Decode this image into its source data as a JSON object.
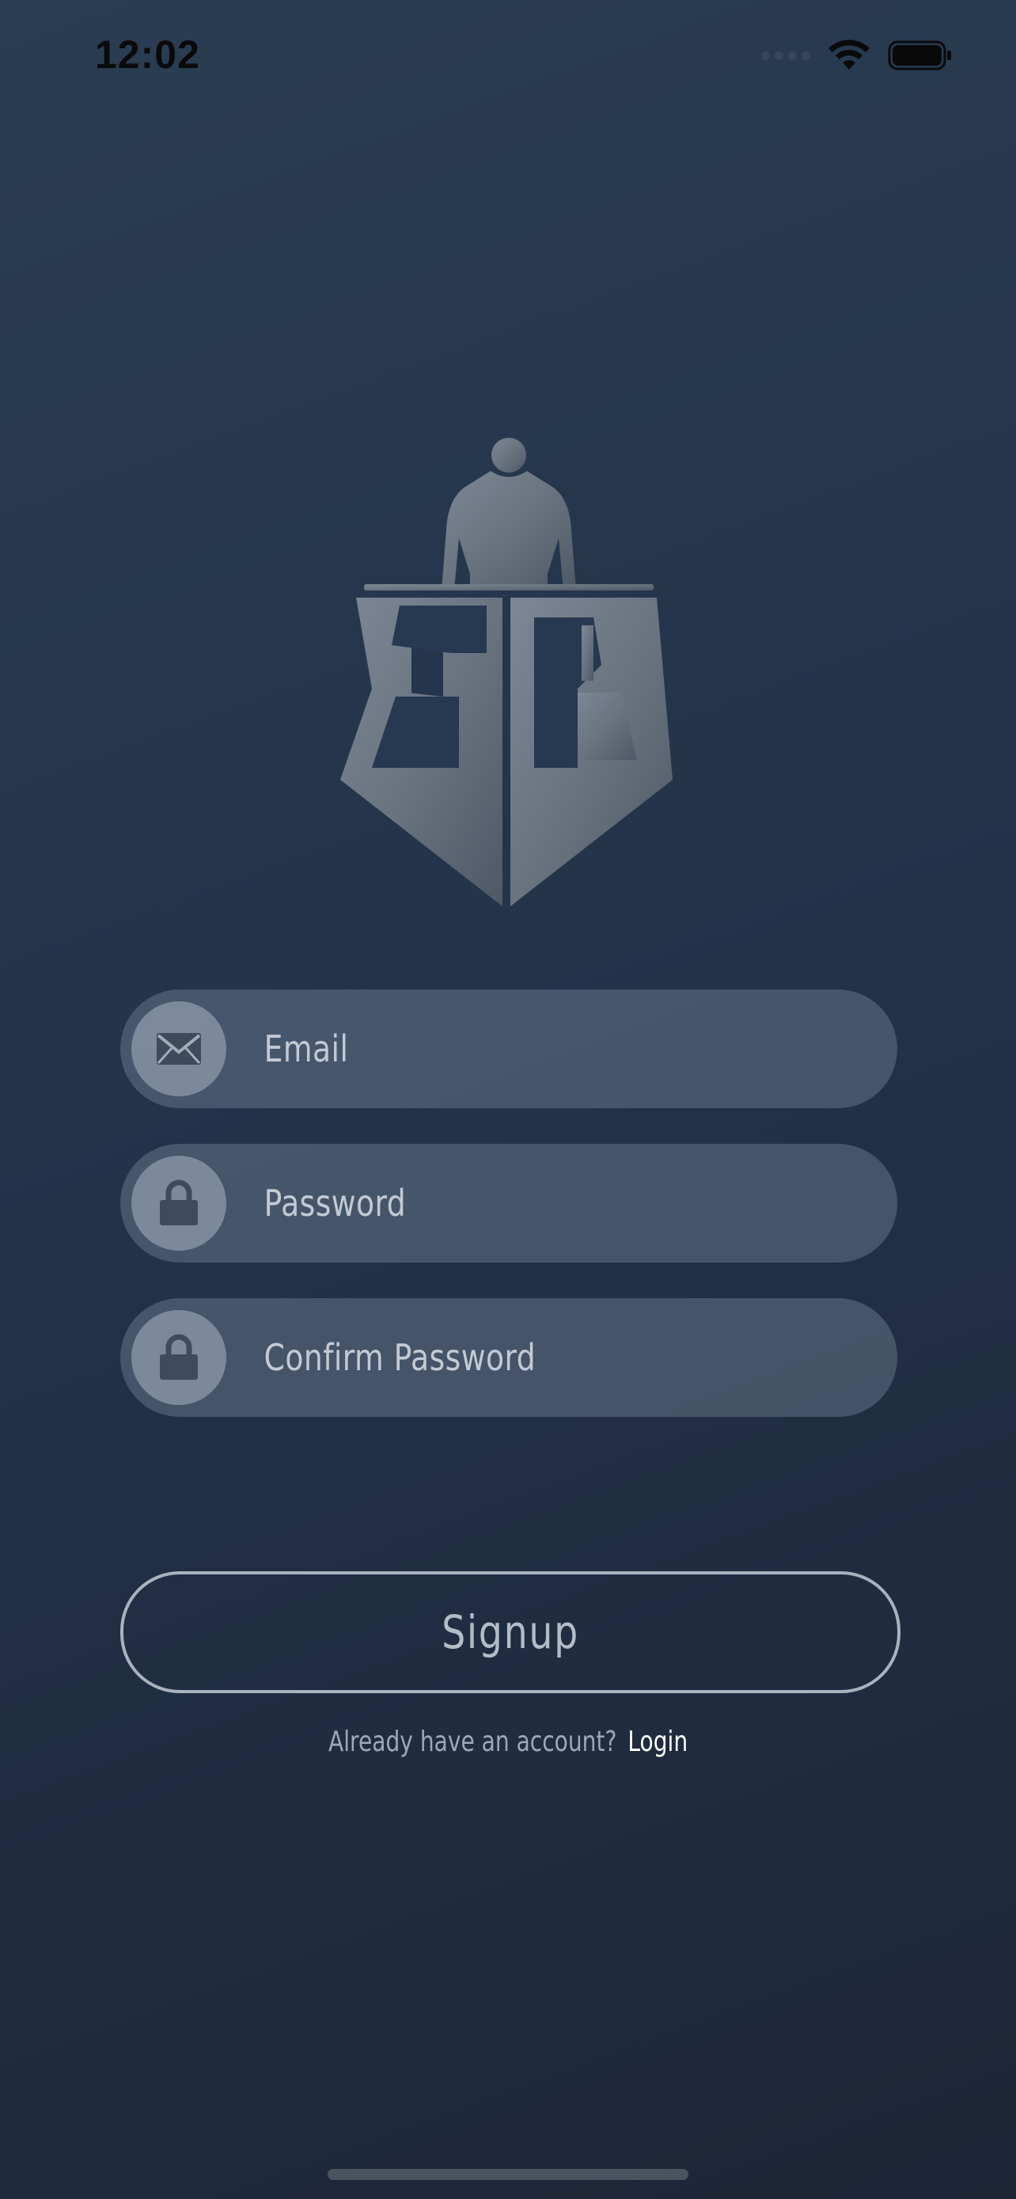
{
  "status_bar": {
    "time": "12:02",
    "icons": [
      "cellular-signal-icon",
      "wifi-icon",
      "battery-icon"
    ]
  },
  "logo": {
    "icon": "sb-athlete-shield-logo"
  },
  "form": {
    "email": {
      "placeholder": "Email",
      "value": "",
      "icon": "envelope-icon"
    },
    "password": {
      "placeholder": "Password",
      "value": "",
      "icon": "lock-icon"
    },
    "confirm_password": {
      "placeholder": "Confirm Password",
      "value": "",
      "icon": "lock-icon"
    }
  },
  "signup": {
    "label": "Signup"
  },
  "login": {
    "prompt": "Already have an account?",
    "link": "Login"
  },
  "colors": {
    "background_top": "#2b3d52",
    "background_bottom": "#1d2637",
    "field_fill": "#4a5668",
    "icon_circle": "#8a94a3",
    "button_border": "#a9b2bf",
    "link": "#ffffff"
  }
}
